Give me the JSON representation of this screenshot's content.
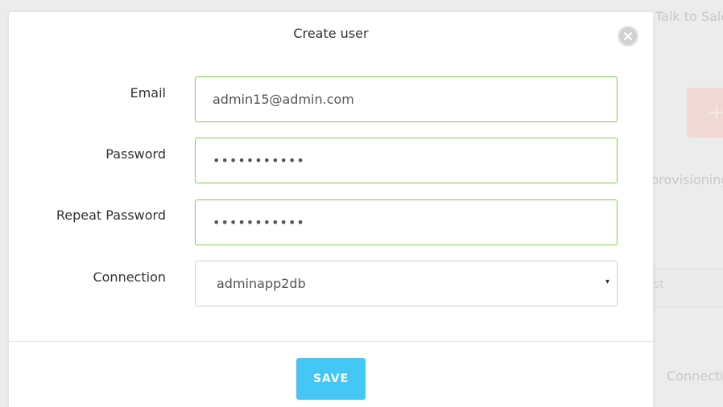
{
  "background": {
    "talk_to_sales": "Talk to Sale",
    "provisioning": "provisioning",
    "connection": "Connecti",
    "row_fragment": "st",
    "plus_label": "+"
  },
  "modal": {
    "title": "Create user",
    "close_icon": "close-icon",
    "fields": {
      "email": {
        "label": "Email",
        "value": "admin15@admin.com"
      },
      "password": {
        "label": "Password",
        "value": "•••••••••••"
      },
      "repeat_password": {
        "label": "Repeat Password",
        "value": "•••••••••••"
      },
      "connection": {
        "label": "Connection",
        "selected": "adminapp2db",
        "caret": "▾"
      }
    },
    "save_label": "SAVE"
  },
  "colors": {
    "accent": "#44c7f4",
    "valid_border": "#7fcf46"
  }
}
